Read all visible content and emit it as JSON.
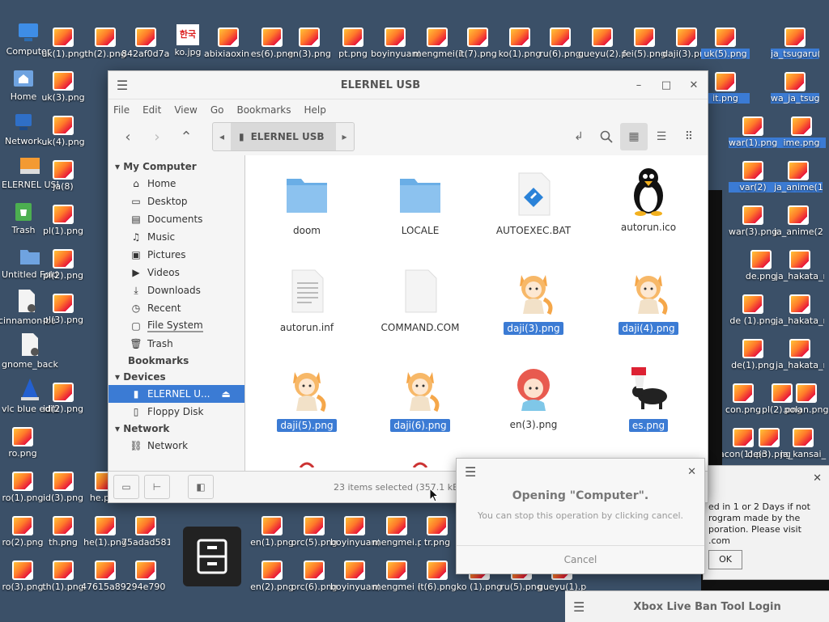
{
  "desktop": {
    "left_icons": [
      {
        "label": "Computer"
      },
      {
        "label": "Home"
      },
      {
        "label": "Network"
      },
      {
        "label": "ELERNEL USB"
      },
      {
        "label": "Trash"
      },
      {
        "label": "Untitled Folder"
      },
      {
        "label": "cinnamon-backup.txt"
      },
      {
        "label": "gnome_backup.txt"
      },
      {
        "label": "vlc blue edition"
      }
    ],
    "png_labels": [
      "uk(1).png",
      "th(2).png",
      "842af0d7a238b7e85ffc2197",
      "ko.jpg",
      "abixiaoxin (1).png",
      "es(6).png",
      "en(3).png",
      "pt.png",
      "boyinyuan(4).png",
      "mengmei(1).png",
      "it(7).png",
      "ko(1).png",
      "ru(6).png",
      "gueyu(2).png",
      "fei(5).png",
      "daji(3).png",
      "uk(3).png",
      "th(3)",
      "uk(4).png",
      "ja(7)",
      "ja(8)",
      "pl(1).png",
      "wa3",
      "pl(2).png",
      "1a94f68",
      "pl(3).png",
      "gueyu(7)",
      "d079e76",
      "id(2).png",
      "64940a",
      "ro.png",
      "ro(1).png",
      "id(3).png",
      "he.png",
      "ro(2).png",
      "th.png",
      "he(1).png",
      "75adad5810",
      "ro(3).png",
      "th(1).png",
      "47615a897",
      "294e790",
      "en(1).png",
      "prc(5).png",
      "boyinyuan(1).png",
      "mengmei.png",
      "tr.png",
      "en(2).png",
      "prc(6).png",
      "boyinyuan(2).png",
      "mengmei (1).png",
      "it(6).png",
      "ko (1).png",
      "ru(5).png",
      "gueyu(1).png"
    ],
    "right_selected": [
      "uk(5).png",
      "ja_tsugaru(1).png",
      "it.png",
      "wa_ja_tsugaru(2).png",
      "war(1).png",
      "ime.png",
      "var(2)",
      "ja_anime(1).png",
      "war(3).png",
      "ja_anime(2).png",
      "de.png",
      "ja_hakata_male.png",
      "de (1).png",
      "ja_hakata_male(1).png",
      "de(1).png",
      "ja_hakata_male(2).png",
      "con.png",
      "pl(2).png",
      "polan.png",
      "acon(1).png",
      "de(3).png",
      "ja_kansai_"
    ]
  },
  "window": {
    "title": "ELERNEL USB",
    "menu": [
      "File",
      "Edit",
      "View",
      "Go",
      "Bookmarks",
      "Help"
    ],
    "path_segment": "ELERNEL USB",
    "sidebar": {
      "my_computer": "My Computer",
      "places": [
        {
          "label": "Home",
          "icon": "home-icon"
        },
        {
          "label": "Desktop",
          "icon": "desktop-icon"
        },
        {
          "label": "Documents",
          "icon": "documents-icon"
        },
        {
          "label": "Music",
          "icon": "music-icon"
        },
        {
          "label": "Pictures",
          "icon": "pictures-icon"
        },
        {
          "label": "Videos",
          "icon": "videos-icon"
        },
        {
          "label": "Downloads",
          "icon": "downloads-icon"
        },
        {
          "label": "Recent",
          "icon": "recent-icon"
        },
        {
          "label": "File System",
          "icon": "filesystem-icon"
        },
        {
          "label": "Trash",
          "icon": "trash-icon"
        }
      ],
      "bookmarks": "Bookmarks",
      "devices": "Devices",
      "device_items": [
        {
          "label": "ELERNEL U...",
          "icon": "usb-icon"
        },
        {
          "label": "Floppy Disk",
          "icon": "floppy-icon"
        }
      ],
      "network": "Network",
      "network_items": [
        {
          "label": "Network",
          "icon": "network-icon"
        }
      ]
    },
    "files": [
      {
        "name": "doom",
        "kind": "folder",
        "selected": false
      },
      {
        "name": "LOCALE",
        "kind": "folder",
        "selected": false
      },
      {
        "name": "AUTOEXEC.BAT",
        "kind": "bat",
        "selected": false
      },
      {
        "name": "autorun.ico",
        "kind": "penguin",
        "selected": false
      },
      {
        "name": "autorun.inf",
        "kind": "text",
        "selected": false
      },
      {
        "name": "COMMAND.COM",
        "kind": "blank",
        "selected": false
      },
      {
        "name": "daji(3).png",
        "kind": "fox",
        "selected": true
      },
      {
        "name": "daji(4).png",
        "kind": "fox",
        "selected": true
      },
      {
        "name": "daji(5).png",
        "kind": "fox",
        "selected": true
      },
      {
        "name": "daji(6).png",
        "kind": "fox",
        "selected": true
      },
      {
        "name": "en(3).png",
        "kind": "girl",
        "selected": false
      },
      {
        "name": "es.png",
        "kind": "bull",
        "selected": true
      }
    ],
    "status": "23 items selected (357.1 kB), Free"
  },
  "dialog": {
    "heading": "Opening \"Computer\".",
    "sub": "You can stop this operation by clicking cancel.",
    "cancel": "Cancel"
  },
  "bg_dialog": {
    "line1": "ed in 1 or 2 Days if not",
    "line2": "rogram made by the",
    "line3": "poration. Please visit",
    "line4": ".com",
    "ok": "OK"
  },
  "xbox_window": {
    "title": "Xbox Live Ban Tool Login"
  }
}
